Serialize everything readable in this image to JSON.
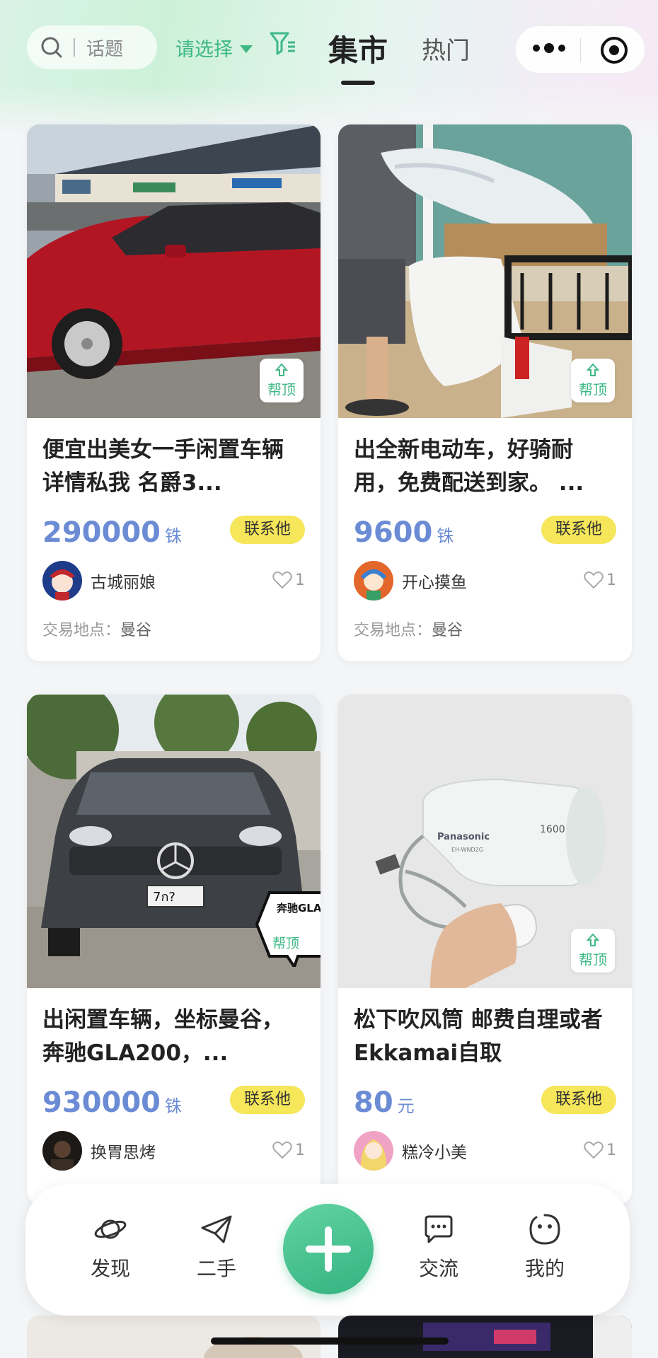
{
  "header": {
    "search_placeholder": "话题",
    "select_label": "请选择",
    "tab_active": "集市",
    "tab_hot": "热门"
  },
  "common": {
    "help_top": "帮顶",
    "contact": "联系他",
    "place_label": "交易地点："
  },
  "cards": [
    {
      "title": "便宜出美女一手闲置车辆 详情私我 名爵3...",
      "price": "290000",
      "unit": "铢",
      "user": "古城丽娘",
      "likes": "1",
      "place": "曼谷"
    },
    {
      "title": "出全新电动车，好骑耐用，免费配送到家。 ...",
      "price": "9600",
      "unit": "铢",
      "user": "开心摸鱼",
      "likes": "1",
      "place": "曼谷"
    },
    {
      "title": "出闲置车辆，坐标曼谷，奔驰GLA200，...",
      "price": "930000",
      "unit": "铢",
      "user": "换胃思烤",
      "likes": "1",
      "badge_text": "奔驰GLA",
      "plate": "7ก?"
    },
    {
      "title": "松下吹风筒 邮费自理或者Ekkamai自取",
      "price": "80",
      "unit": "元",
      "user": "糕冷小美",
      "likes": "1",
      "brand": "Panasonic",
      "watt": "1600",
      "model": "EH-WND2G"
    }
  ],
  "nav": {
    "discover": "发现",
    "secondhand": "二手",
    "chat": "交流",
    "mine": "我的"
  },
  "colors": {
    "accent": "#3fb886",
    "price": "#6b8cd4",
    "contact_bg": "#f5e65a"
  }
}
